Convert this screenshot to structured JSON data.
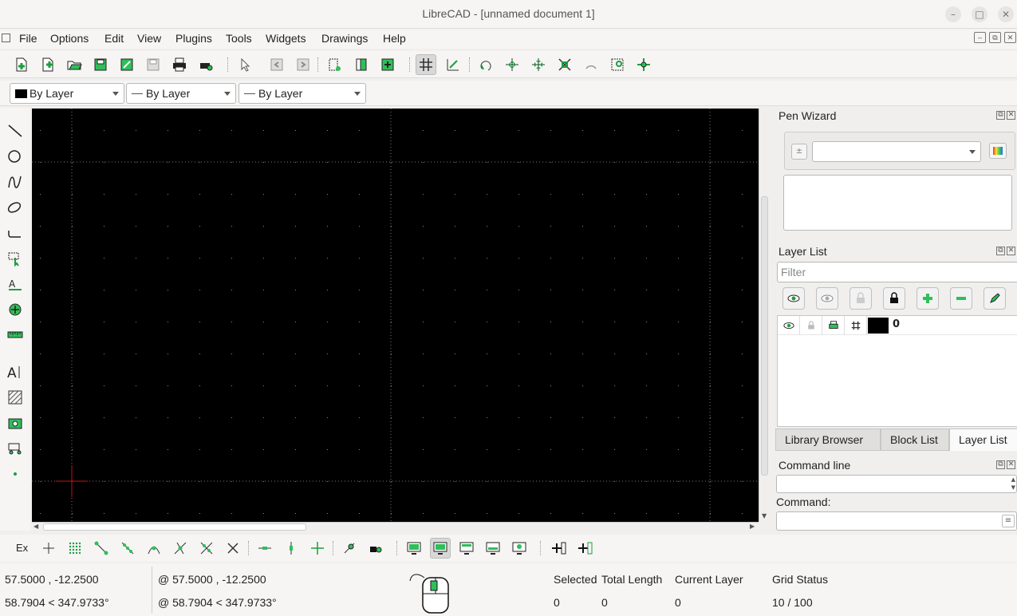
{
  "window": {
    "title": "LibreCAD - [unnamed document 1]"
  },
  "menu": [
    "File",
    "Options",
    "Edit",
    "View",
    "Plugins",
    "Tools",
    "Widgets",
    "Drawings",
    "Help"
  ],
  "pen_toolbar": {
    "color": "By Layer",
    "width": "By Layer",
    "type": "By Layer"
  },
  "pen_wizard": {
    "title": "Pen Wizard"
  },
  "layer_list": {
    "title": "Layer List",
    "filter_placeholder": "Filter",
    "layers": [
      {
        "name": "0",
        "color": "#000000"
      }
    ]
  },
  "tabs": [
    "Library Browser",
    "Block List",
    "Layer List"
  ],
  "command_line": {
    "title": "Command line",
    "prompt": "Command:"
  },
  "status": {
    "abs_coord": "57.5000 , -12.2500",
    "abs_polar": "58.7904 < 347.9733°",
    "rel_coord": "@  57.5000 , -12.2500",
    "rel_polar": "@  58.7904 < 347.9733°",
    "selected_label": "Selected",
    "selected_value": "0",
    "total_length_label": "Total Length",
    "total_length_value": "0",
    "current_layer_label": "Current Layer",
    "current_layer_value": "0",
    "grid_status_label": "Grid Status",
    "grid_status_value": "10 / 100"
  },
  "snap_toolbar": {
    "exclusive_label": "Ex"
  },
  "colors": {
    "accent": "#22aa44",
    "canvas": "#000000",
    "cursor": "#cc1111"
  }
}
